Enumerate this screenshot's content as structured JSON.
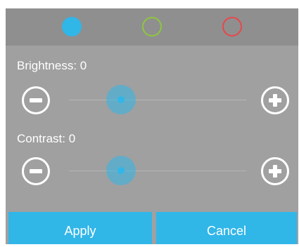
{
  "color_selector": {
    "options": [
      {
        "name": "blue",
        "color": "#31b6e8",
        "selected": true
      },
      {
        "name": "green",
        "color": "#8ec63f",
        "selected": false
      },
      {
        "name": "red",
        "color": "#e8474b",
        "selected": false
      }
    ]
  },
  "brightness": {
    "label": "Brightness: 0",
    "value": 0,
    "min": -100,
    "max": 100
  },
  "contrast": {
    "label": "Contrast: 0",
    "value": 0,
    "min": -100,
    "max": 100
  },
  "buttons": {
    "apply_label": "Apply",
    "cancel_label": "Cancel"
  },
  "colors": {
    "accent": "#31b6e8",
    "panel": "#a0a0a0",
    "topbar": "#8f8f8f"
  }
}
